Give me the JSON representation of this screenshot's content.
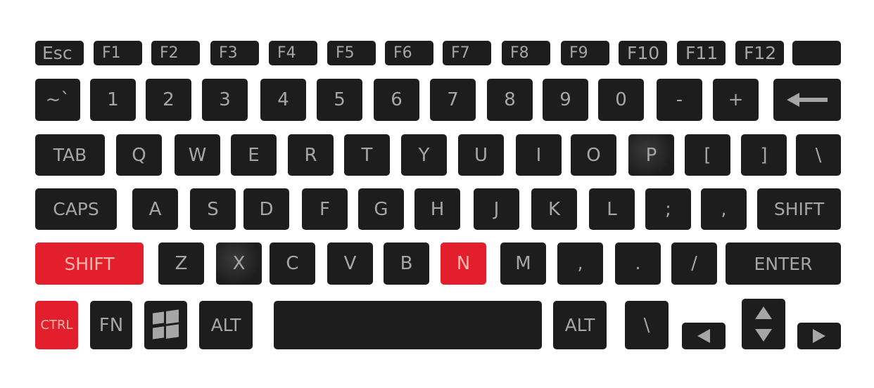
{
  "colors": {
    "key": "#1d1d1d",
    "label": "#a6a6a6",
    "highlight": "#e31e2d",
    "highlight_label": "#f6b9ad"
  },
  "rows": [
    [
      {
        "label": "Esc"
      },
      {
        "label": "F1"
      },
      {
        "label": "F2"
      },
      {
        "label": "F3"
      },
      {
        "label": "F4"
      },
      {
        "label": "F5"
      },
      {
        "label": "F6"
      },
      {
        "label": "F7"
      },
      {
        "label": "F8"
      },
      {
        "label": "F9"
      },
      {
        "label": "F10"
      },
      {
        "label": "F11"
      },
      {
        "label": "F12"
      },
      {
        "label": ""
      }
    ],
    [
      {
        "label": "~`"
      },
      {
        "label": "1"
      },
      {
        "label": "2"
      },
      {
        "label": "3"
      },
      {
        "label": "4"
      },
      {
        "label": "5"
      },
      {
        "label": "6"
      },
      {
        "label": "7"
      },
      {
        "label": "8"
      },
      {
        "label": "9"
      },
      {
        "label": "0"
      },
      {
        "label": "-"
      },
      {
        "label": "+"
      },
      {
        "label": "",
        "icon": "backspace-arrow-icon"
      }
    ],
    [
      {
        "label": "TAB"
      },
      {
        "label": "Q"
      },
      {
        "label": "W"
      },
      {
        "label": "E"
      },
      {
        "label": "R"
      },
      {
        "label": "T"
      },
      {
        "label": "Y"
      },
      {
        "label": "U"
      },
      {
        "label": "I"
      },
      {
        "label": "O"
      },
      {
        "label": "P",
        "highlighted_glow": true
      },
      {
        "label": "["
      },
      {
        "label": "]"
      },
      {
        "label": "\\"
      }
    ],
    [
      {
        "label": "CAPS"
      },
      {
        "label": "A"
      },
      {
        "label": "S"
      },
      {
        "label": "D"
      },
      {
        "label": "F"
      },
      {
        "label": "G"
      },
      {
        "label": "H"
      },
      {
        "label": "J"
      },
      {
        "label": "K"
      },
      {
        "label": "L"
      },
      {
        "label": ";"
      },
      {
        "label": ","
      },
      {
        "label": "SHIFT"
      }
    ],
    [
      {
        "label": "SHIFT",
        "pressed": true
      },
      {
        "label": "Z"
      },
      {
        "label": "X",
        "highlighted_glow": true
      },
      {
        "label": "C"
      },
      {
        "label": "V"
      },
      {
        "label": "B"
      },
      {
        "label": "N",
        "pressed": true
      },
      {
        "label": "M"
      },
      {
        "label": ","
      },
      {
        "label": "."
      },
      {
        "label": "/"
      },
      {
        "label": "ENTER"
      }
    ],
    [
      {
        "label": "CTRL",
        "pressed": true
      },
      {
        "label": "FN"
      },
      {
        "label": "",
        "icon": "windows-logo-icon"
      },
      {
        "label": "ALT"
      },
      {
        "label": "",
        "icon": "spacebar"
      },
      {
        "label": "ALT"
      },
      {
        "label": "\\"
      },
      {
        "label": "",
        "icon": "arrow-left-icon"
      },
      {
        "label": "",
        "icon": "arrow-up-down-icon"
      },
      {
        "label": "",
        "icon": "arrow-right-icon"
      }
    ]
  ]
}
